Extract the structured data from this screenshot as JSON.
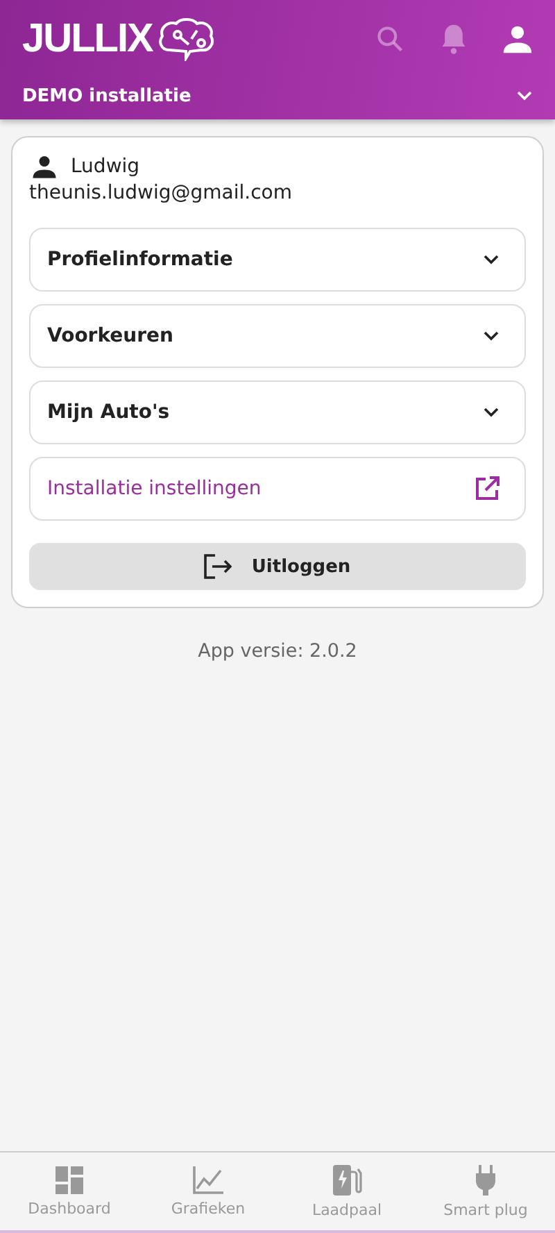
{
  "header": {
    "logo": "JULLIX",
    "actions": [
      {
        "kind": "search",
        "disabled": true
      },
      {
        "kind": "bell",
        "disabled": true
      },
      {
        "kind": "person",
        "disabled": false
      }
    ],
    "installation": "DEMO installatie"
  },
  "profile": {
    "name": "Ludwig",
    "email": "theunis.ludwig@gmail.com",
    "sections": [
      {
        "kind": "accordion",
        "label": "Profielinformatie"
      },
      {
        "kind": "accordion",
        "label": "Voorkeuren"
      },
      {
        "kind": "accordion",
        "label": "Mijn Auto's"
      },
      {
        "kind": "link",
        "label": "Installatie instellingen"
      }
    ],
    "logout": "Uitloggen"
  },
  "version": "App versie: 2.0.2",
  "nav": [
    {
      "kind": "dashboard",
      "label": "Dashboard",
      "selected": false
    },
    {
      "kind": "chart",
      "label": "Grafieken",
      "selected": false
    },
    {
      "kind": "charger",
      "label": "Laadpaal",
      "selected": false
    },
    {
      "kind": "plug",
      "label": "Smart plug",
      "selected": false
    }
  ]
}
